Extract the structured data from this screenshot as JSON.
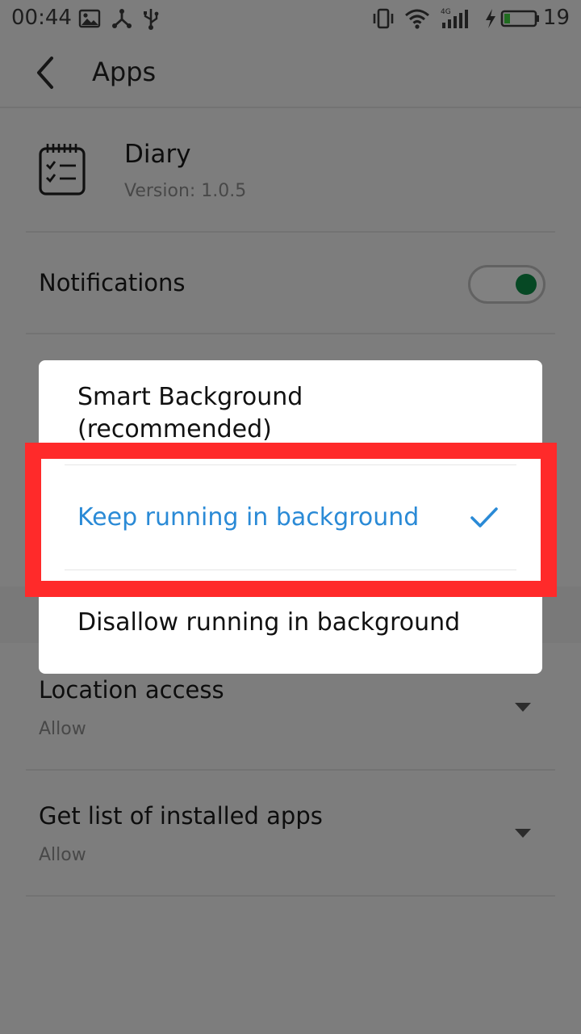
{
  "status_bar": {
    "time": "00:44",
    "battery_level": "19",
    "icons": [
      "image-icon",
      "usb-share-icon",
      "usb-icon",
      "vibrate-icon",
      "wifi-icon",
      "signal-4g-icon",
      "charging-icon",
      "battery-icon"
    ],
    "signal_label": "4G",
    "battery_fill_fraction": 0.19,
    "battery_color": "#3fcf3f"
  },
  "header": {
    "title": "Apps",
    "back_icon": "chevron-left-icon"
  },
  "app": {
    "name": "Diary",
    "version": "Version: 1.0.5",
    "icon": "notebook-checklist-icon"
  },
  "settings": {
    "notifications": {
      "label": "Notifications",
      "enabled": true,
      "toggle_color": "#0d8a46"
    },
    "location_access": {
      "label": "Location access",
      "value": "Allow"
    },
    "installed_apps": {
      "label": "Get list of installed apps",
      "value": "Allow"
    }
  },
  "dialog": {
    "options": [
      {
        "label": "Smart Background (recommended)",
        "line1": "Smart Background",
        "line2": "(recommended)",
        "selected": false
      },
      {
        "label": "Keep running in background",
        "selected": true
      },
      {
        "label": "Disallow running in background",
        "selected": false
      }
    ],
    "accent_color": "#2a8ad6",
    "check_icon": "checkmark-icon"
  },
  "annotation": {
    "highlight_color": "#ff2a2a"
  }
}
